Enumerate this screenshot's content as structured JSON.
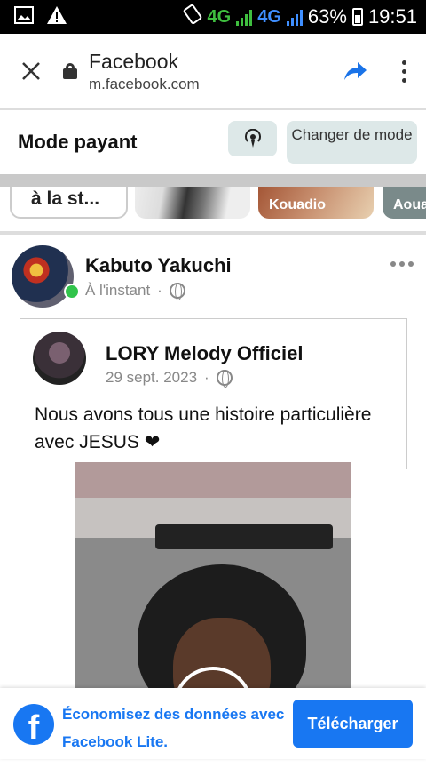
{
  "status_bar": {
    "network1": "4G",
    "network1_sup": "4G",
    "network2": "4G",
    "battery": "63%",
    "time": "19:51"
  },
  "browser": {
    "title": "Facebook",
    "url": "m.facebook.com"
  },
  "mode_bar": {
    "label": "Mode payant",
    "change_button": "Changer de mode"
  },
  "stories": {
    "text_story": "à la st...",
    "story2_name": "Kouadio",
    "story3_name": "Aoua"
  },
  "post": {
    "author": "Kabuto Yakuchi",
    "time": "À l'instant",
    "separator": "·",
    "shared": {
      "author": "LORY Melody Officiel",
      "date": "29 sept. 2023",
      "separator": "·",
      "text": "Nous avons tous une histoire particulière avec JESUS ❤"
    }
  },
  "banner": {
    "text": "Économisez des données avec Facebook Lite.",
    "button": "Télécharger",
    "logo_letter": "f"
  },
  "colors": {
    "accent": "#1877f2",
    "online": "#31c44b",
    "mode_button_bg": "#dde8e8"
  }
}
